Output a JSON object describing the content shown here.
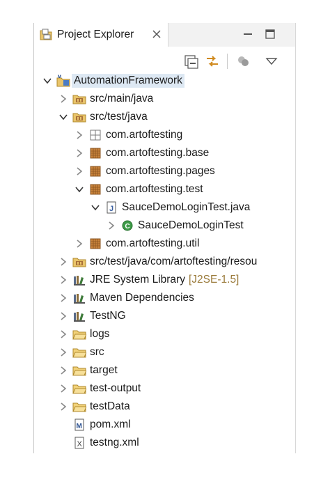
{
  "view": {
    "title": "Project Explorer"
  },
  "tree": [
    {
      "label": "AutomationFramework",
      "icon": "maven-project-icon",
      "depth": 0,
      "state": "expanded",
      "selected": true
    },
    {
      "label": "src/main/java",
      "icon": "source-folder-icon",
      "depth": 1,
      "state": "collapsed"
    },
    {
      "label": "src/test/java",
      "icon": "source-folder-icon",
      "depth": 1,
      "state": "expanded"
    },
    {
      "label": "com.artoftesting",
      "icon": "empty-package-icon",
      "depth": 2,
      "state": "collapsed"
    },
    {
      "label": "com.artoftesting.base",
      "icon": "package-icon",
      "depth": 2,
      "state": "collapsed"
    },
    {
      "label": "com.artoftesting.pages",
      "icon": "package-icon",
      "depth": 2,
      "state": "collapsed"
    },
    {
      "label": "com.artoftesting.test",
      "icon": "package-icon",
      "depth": 2,
      "state": "expanded"
    },
    {
      "label": "SauceDemoLoginTest.java",
      "icon": "java-file-icon",
      "depth": 3,
      "state": "expanded"
    },
    {
      "label": "SauceDemoLoginTest",
      "icon": "class-icon",
      "depth": 4,
      "state": "collapsed"
    },
    {
      "label": "com.artoftesting.util",
      "icon": "package-icon",
      "depth": 2,
      "state": "collapsed"
    },
    {
      "label": "src/test/java/com/artoftesting/resou",
      "icon": "source-folder-icon",
      "depth": 1,
      "state": "collapsed"
    },
    {
      "label": "JRE System Library",
      "decoration": "[J2SE-1.5]",
      "icon": "library-icon",
      "depth": 1,
      "state": "collapsed"
    },
    {
      "label": "Maven Dependencies",
      "icon": "library-icon",
      "depth": 1,
      "state": "collapsed"
    },
    {
      "label": "TestNG",
      "icon": "library-icon",
      "depth": 1,
      "state": "collapsed"
    },
    {
      "label": "logs",
      "icon": "folder-icon",
      "depth": 1,
      "state": "collapsed"
    },
    {
      "label": "src",
      "icon": "folder-icon",
      "depth": 1,
      "state": "collapsed"
    },
    {
      "label": "target",
      "icon": "folder-icon",
      "depth": 1,
      "state": "collapsed"
    },
    {
      "label": "test-output",
      "icon": "folder-icon",
      "depth": 1,
      "state": "collapsed"
    },
    {
      "label": "testData",
      "icon": "folder-icon",
      "depth": 1,
      "state": "collapsed"
    },
    {
      "label": "pom.xml",
      "icon": "maven-pom-icon",
      "depth": 1,
      "state": "leaf"
    },
    {
      "label": "testng.xml",
      "icon": "xml-file-icon",
      "depth": 1,
      "state": "leaf"
    }
  ]
}
